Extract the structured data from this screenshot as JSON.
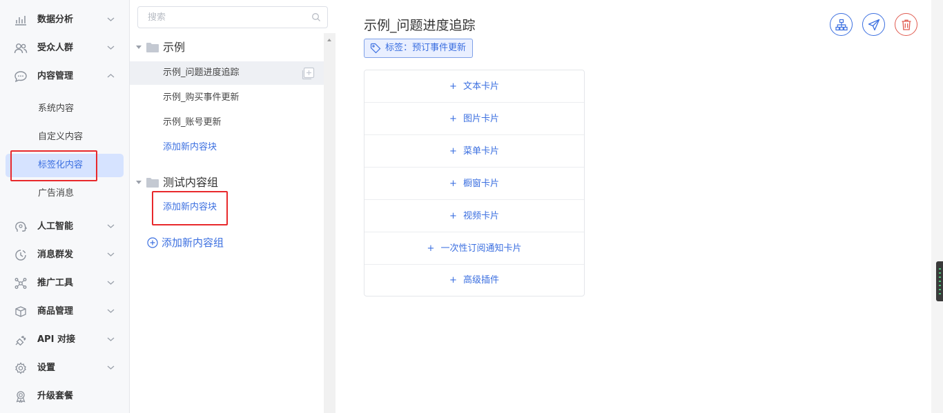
{
  "sidebar": {
    "items": [
      {
        "label": "数据分析",
        "icon": "bar-chart-icon",
        "expanded": false
      },
      {
        "label": "受众人群",
        "icon": "users-icon",
        "expanded": false
      },
      {
        "label": "内容管理",
        "icon": "chat-bubble-icon",
        "expanded": true
      },
      {
        "label": "人工智能",
        "icon": "ai-head-icon",
        "expanded": false
      },
      {
        "label": "消息群发",
        "icon": "clock-icon",
        "expanded": false
      },
      {
        "label": "推广工具",
        "icon": "network-icon",
        "expanded": false
      },
      {
        "label": "商品管理",
        "icon": "box-icon",
        "expanded": false
      },
      {
        "label": "API 对接",
        "icon": "plug-icon",
        "expanded": false
      },
      {
        "label": "设置",
        "icon": "gear-icon",
        "expanded": false
      },
      {
        "label": "升级套餐",
        "icon": "badge-icon"
      }
    ],
    "content_sub": [
      {
        "label": "系统内容"
      },
      {
        "label": "自定义内容"
      },
      {
        "label": "标签化内容",
        "active": true
      },
      {
        "label": "广告消息"
      }
    ]
  },
  "middle": {
    "search_placeholder": "搜索",
    "groups": [
      {
        "name": "示例",
        "blocks": [
          "示例_问题进度追踪",
          "示例_购买事件更新",
          "示例_账号更新"
        ],
        "add_block": "添加新内容块"
      },
      {
        "name": "测试内容组",
        "blocks": [],
        "add_block": "添加新内容块"
      }
    ],
    "add_group": "添加新内容组"
  },
  "main": {
    "title": "示例_问题进度追踪",
    "tag": "标签：预订事件更新",
    "actions": [
      "sitemap-icon",
      "send-icon",
      "trash-icon"
    ],
    "card_options": [
      "文本卡片",
      "图片卡片",
      "菜单卡片",
      "橱窗卡片",
      "视频卡片",
      "一次性订阅通知卡片",
      "高级插件"
    ],
    "plus": "+"
  },
  "colors": {
    "accent": "#3b6fe0",
    "danger": "#e05a4f",
    "highlight": "#e8282b",
    "active_bg": "#d6e3ff"
  }
}
